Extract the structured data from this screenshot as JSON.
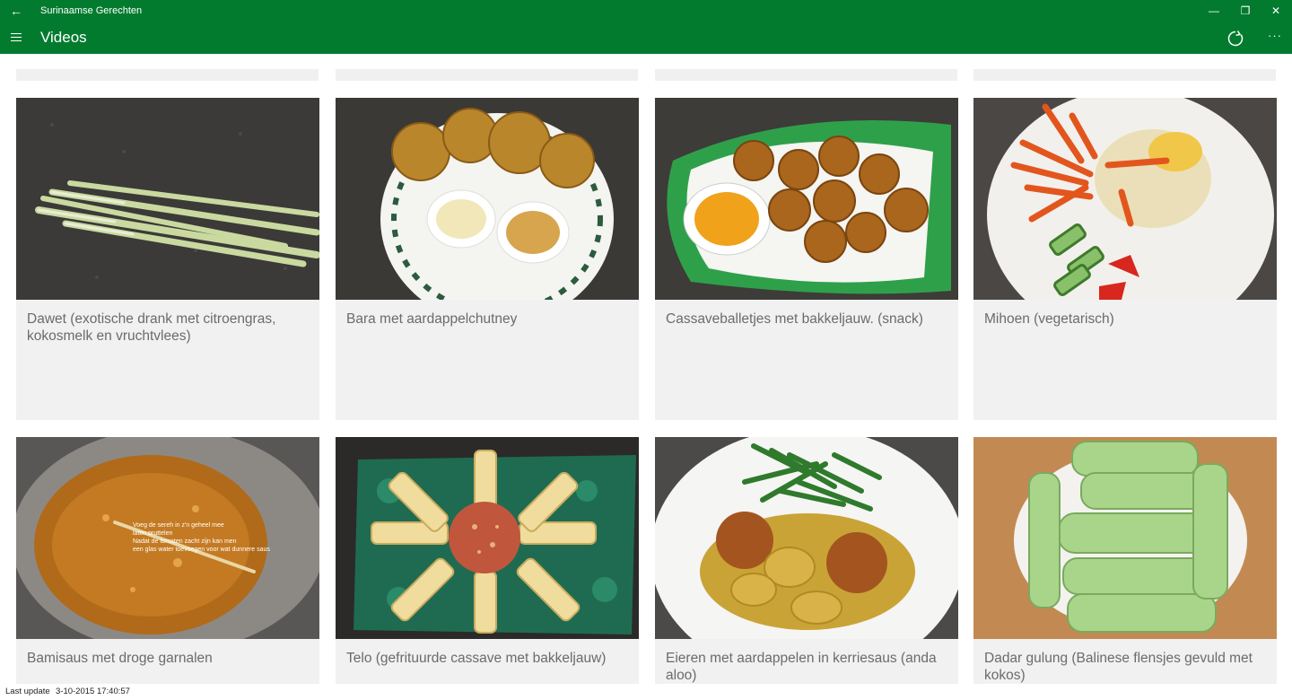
{
  "window": {
    "title": "Surinaamse Gerechten",
    "back_icon": "←",
    "minimize_icon": "—",
    "maximize_icon": "❐",
    "close_icon": "✕"
  },
  "header": {
    "title": "Videos",
    "more_icon": "···"
  },
  "cards": [
    {
      "label": "Dawet (exotische drank met citroengras, kokosmelk en vruchtvlees)"
    },
    {
      "label": "Bara met aardappelchutney"
    },
    {
      "label": "Cassaveballetjes met bakkeljauw. (snack)"
    },
    {
      "label": "Mihoen (vegetarisch)"
    },
    {
      "label": "Bamisaus met droge garnalen"
    },
    {
      "label": "Telo (gefrituurde cassave met bakkeljauw)"
    },
    {
      "label": "Eieren met aardappelen in kerriesaus (anda aloo)"
    },
    {
      "label": "Dadar gulung (Balinese flensjes gevuld met kokos)"
    }
  ],
  "status": {
    "label": "Last update",
    "value": "3-10-2015 17:40:57"
  },
  "colors": {
    "accent": "#037b2f",
    "card_bg": "#f1f1f1",
    "label_text": "#6b6b6b"
  }
}
